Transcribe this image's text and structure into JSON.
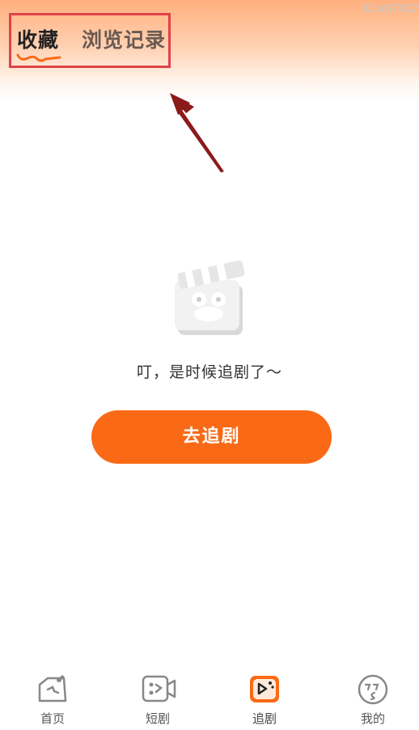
{
  "watermark": "ID:a87427",
  "tabs": {
    "favorites": "收藏",
    "history": "浏览记录"
  },
  "empty": {
    "message": "叮，是时候追剧了～",
    "button": "去追剧"
  },
  "bottom_nav": {
    "items": [
      {
        "label": "首页",
        "icon": "home-icon"
      },
      {
        "label": "短剧",
        "icon": "short-drama-icon"
      },
      {
        "label": "追剧",
        "icon": "follow-drama-icon",
        "active": true
      },
      {
        "label": "我的",
        "icon": "profile-icon"
      }
    ]
  },
  "colors": {
    "accent": "#fa6a16",
    "highlight_box": "#e0424a",
    "arrow": "#8b1a1a"
  }
}
